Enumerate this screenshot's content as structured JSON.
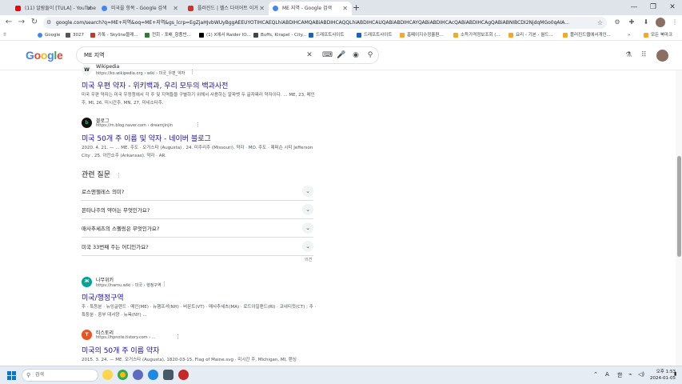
{
  "browser": {
    "tabs": [
      {
        "title": "(11) 알람들이 [TULA] - YouTube",
        "active": false
      },
      {
        "title": "미국을 항목 - Google 검색",
        "active": false
      },
      {
        "title": "플러진드 | 헬스 다이어트 이거",
        "active": false
      },
      {
        "title": "ME 지역 - Google 검색",
        "active": true
      }
    ],
    "url": "google.com/search?q=ME+지역&oq=ME+지역&gs_lcrp=EgZjaHJvbWUyBggAEEUYOTIHCAEQLhiABDIHCAMQABiABDIHCAQQLhiABDIHCAUQABiABDIHCAYQABiABDIHCAcQABiABDIHCAgQABiABNIBCDI2NjdqMGo0qAIA...",
    "bookmarks": [
      "Google",
      "3027",
      "카톡 - Skyline블래...",
      "전회 - 포배_항품반...",
      "(1) X에서 Raider IO...",
      "Buffs, Kirapel - City...",
      "드래프트사이트",
      "드래프트사이트",
      "홈페이지수정흘편...",
      "소득가격정보조회 (...",
      "요리 - 기본 - 월드...",
      "플러진드웹에서개인..."
    ],
    "bookmarks_all": "모든 북마크"
  },
  "search": {
    "query": "ME 지역"
  },
  "results": [
    {
      "site": "Wikipedia",
      "url": "https://ko.wikipedia.org › wiki › 미국_우편_약자",
      "title": "미국 우편 약자 - 위키백과, 우리 모두의 백과사전",
      "snippet": "미국 우편 약자는 미국 우정청에서 각 주 및 지역들을 구별하기 위해서 사용하는 알파벳 두 글자짜리 약자이다. ... ME, 23, 메인주, MI, 26, 미시간주, MN, 27, 미네소타주."
    },
    {
      "site": "블로그",
      "url": "https://m.blog.naver.com › dreamjinjin",
      "title": "미국 50개 주 이름 및 약자 - 네이버 블로그",
      "snippet": "2020. 4. 21. — ... ME. 주도 · 오거스타 (Augusta) . 24. 미주리주 (Missouri). 약자 · MO. 주도 · 제퍼슨 시티 Jefferson City . 25. 아칸소주 (Arkansas). 약자 · AR."
    },
    {
      "site": "나무위키",
      "url": "https://namu.wiki › 미국 › 행정구역",
      "title": "미국/행정구역",
      "snippet": "주 · 특등분 · 뉴잉글랜드 · 메인(ME) · 뉴햄프셔(NH) · 버몬트(VT) · 매사추세츠(MA) · 로드아일랜드(RI) · 코네티컷(CT) ; 주 · 특등분 · 중부 대서양 · 뉴욕(NY) ..."
    },
    {
      "site": "티스토리",
      "url": "https://hpnote.tistory.com › ...",
      "title": "미국의 50개 주 이름 약자",
      "snippet": "2015. 3. 24. — ME. 오거스타 (Augusta), 1820-03-15, Flag of Maine.svg · 미시간 주, Michigan, MI, 랜싱"
    }
  ],
  "related": {
    "heading": "관련 질문",
    "questions": [
      "로스앤젤레스 의미?",
      "몬타나주의 약어는 무엇인가요?",
      "매사추세츠의 스펠링은 무엇인가요?",
      "미국 33번째 주는 어디인가요?"
    ],
    "feedback": "의견"
  },
  "taskbar": {
    "search_placeholder": "검색",
    "ime": "A",
    "lang": "한",
    "time": "오후 1:53",
    "date": "2024-01-05"
  }
}
